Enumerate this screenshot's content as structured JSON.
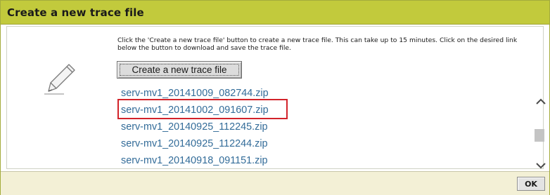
{
  "dialog": {
    "title": "Create a new trace file",
    "description": "Click the 'Create a new trace file' button to create a new trace file. This can take up to 15 minutes. Click on the desired link below the button to download and save the trace file.",
    "create_button_label": "Create a new trace file",
    "ok_label": "OK",
    "icon": "pencil-icon"
  },
  "trace_files": [
    "serv-mv1_20141009_082744.zip",
    "serv-mv1_20141002_091607.zip",
    "serv-mv1_20140925_112245.zip",
    "serv-mv1_20140925_112244.zip",
    "serv-mv1_20140918_091151.zip"
  ],
  "highlighted_index": 1,
  "colors": {
    "title_bar": "#c2ca3c",
    "link": "#336c99",
    "highlight_border": "#d2232a",
    "footer": "#f3f0d6"
  }
}
